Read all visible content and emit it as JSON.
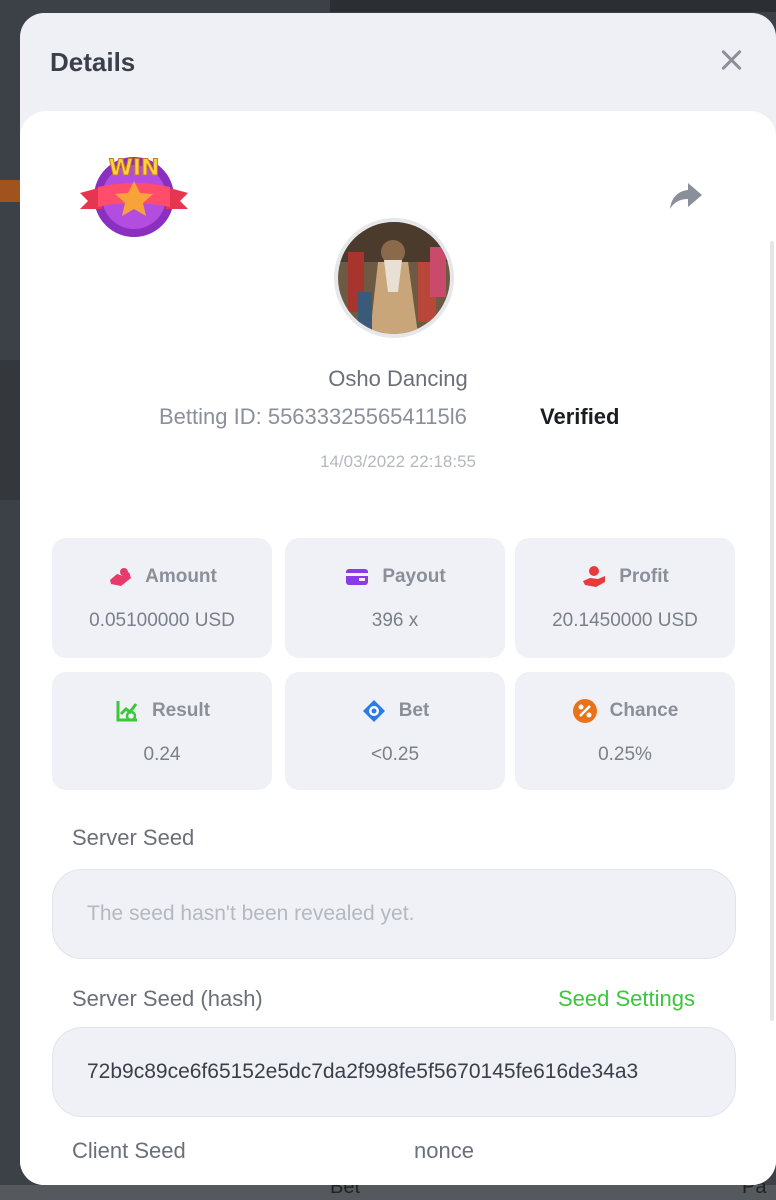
{
  "modal": {
    "title": "Details"
  },
  "game": {
    "name": "Osho Dancing",
    "betting_id_label": "Betting ID: 556333255654115l6",
    "verified": "Verified",
    "datetime": "14/03/2022 22:18:55",
    "badge_text": "WIN"
  },
  "stats": [
    {
      "label": "Amount",
      "value": "0.05100000 USD",
      "icon": "hand-money-icon",
      "color": "#e83a6a"
    },
    {
      "label": "Payout",
      "value": "396 x",
      "icon": "card-icon",
      "color": "#8b3ae8"
    },
    {
      "label": "Profit",
      "value": "20.1450000 USD",
      "icon": "profit-hand-icon",
      "color": "#e83a3a"
    },
    {
      "label": "Result",
      "value": "0.24",
      "icon": "result-chart-icon",
      "color": "#3cc63c"
    },
    {
      "label": "Bet",
      "value": "<0.25",
      "icon": "bet-target-icon",
      "color": "#2a7ae8"
    },
    {
      "label": "Chance",
      "value": "0.25%",
      "icon": "percent-icon",
      "color": "#e8731a"
    }
  ],
  "server_seed": {
    "label": "Server Seed",
    "placeholder": "The seed hasn't been revealed yet."
  },
  "server_seed_hash": {
    "label": "Server Seed (hash)",
    "link": "Seed Settings",
    "value": "72b9c89ce6f65152e5dc7da2f998fe5f5670145fe616de34a3"
  },
  "client_seed": {
    "label": "Client Seed",
    "nonce_label": "nonce"
  },
  "background": {
    "bottom_left": "Bet",
    "bottom_right": "Pa"
  }
}
